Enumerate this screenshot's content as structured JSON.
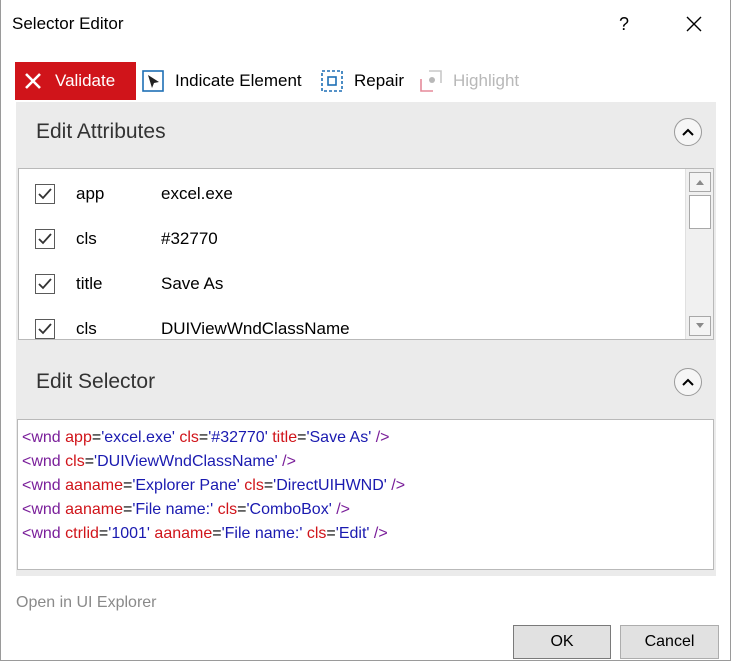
{
  "window": {
    "title": "Selector Editor",
    "help_label": "?"
  },
  "toolbar": {
    "validate_label": "Validate",
    "indicate_label": "Indicate Element",
    "repair_label": "Repair",
    "highlight_label": "Highlight"
  },
  "attributes_panel": {
    "title": "Edit Attributes",
    "rows": [
      {
        "checked": true,
        "name": "app",
        "value": "excel.exe"
      },
      {
        "checked": true,
        "name": "cls",
        "value": "#32770"
      },
      {
        "checked": true,
        "name": "title",
        "value": "Save As"
      },
      {
        "checked": true,
        "name": "cls",
        "value": "DUIViewWndClassName"
      }
    ]
  },
  "selector_panel": {
    "title": "Edit Selector",
    "lines": [
      [
        {
          "t": "tag",
          "v": "<wnd "
        },
        {
          "t": "an",
          "v": "app"
        },
        {
          "t": "eq",
          "v": "="
        },
        {
          "t": "av",
          "v": "'excel.exe'"
        },
        {
          "t": "eq",
          "v": " "
        },
        {
          "t": "an",
          "v": "cls"
        },
        {
          "t": "eq",
          "v": "="
        },
        {
          "t": "av",
          "v": "'#32770'"
        },
        {
          "t": "eq",
          "v": " "
        },
        {
          "t": "an",
          "v": "title"
        },
        {
          "t": "eq",
          "v": "="
        },
        {
          "t": "av",
          "v": "'Save As'"
        },
        {
          "t": "tag",
          "v": " />"
        }
      ],
      [
        {
          "t": "tag",
          "v": "<wnd "
        },
        {
          "t": "an",
          "v": "cls"
        },
        {
          "t": "eq",
          "v": "="
        },
        {
          "t": "av",
          "v": "'DUIViewWndClassName'"
        },
        {
          "t": "tag",
          "v": " />"
        }
      ],
      [
        {
          "t": "tag",
          "v": "<wnd "
        },
        {
          "t": "an",
          "v": "aaname"
        },
        {
          "t": "eq",
          "v": "="
        },
        {
          "t": "av",
          "v": "'Explorer Pane'"
        },
        {
          "t": "eq",
          "v": " "
        },
        {
          "t": "an",
          "v": "cls"
        },
        {
          "t": "eq",
          "v": "="
        },
        {
          "t": "av",
          "v": "'DirectUIHWND'"
        },
        {
          "t": "tag",
          "v": " />"
        }
      ],
      [
        {
          "t": "tag",
          "v": "<wnd "
        },
        {
          "t": "an",
          "v": "aaname"
        },
        {
          "t": "eq",
          "v": "="
        },
        {
          "t": "av",
          "v": "'File name:'"
        },
        {
          "t": "eq",
          "v": " "
        },
        {
          "t": "an",
          "v": "cls"
        },
        {
          "t": "eq",
          "v": "="
        },
        {
          "t": "av",
          "v": "'ComboBox'"
        },
        {
          "t": "tag",
          "v": " />"
        }
      ],
      [
        {
          "t": "tag",
          "v": "<wnd "
        },
        {
          "t": "an",
          "v": "ctrlid"
        },
        {
          "t": "eq",
          "v": "="
        },
        {
          "t": "av",
          "v": "'1001'"
        },
        {
          "t": "eq",
          "v": " "
        },
        {
          "t": "an",
          "v": "aaname"
        },
        {
          "t": "eq",
          "v": "="
        },
        {
          "t": "av",
          "v": "'File name:'"
        },
        {
          "t": "eq",
          "v": " "
        },
        {
          "t": "an",
          "v": "cls"
        },
        {
          "t": "eq",
          "v": "="
        },
        {
          "t": "av",
          "v": "'Edit'"
        },
        {
          "t": "tag",
          "v": " />"
        }
      ]
    ]
  },
  "footer": {
    "open_explorer_label": "Open in UI Explorer",
    "ok_label": "OK",
    "cancel_label": "Cancel"
  },
  "colors": {
    "validate_bg": "#d0141a",
    "tag": "#7a1f9a",
    "attr_name": "#d0141a",
    "attr_value": "#1a1ab0",
    "accent_blue": "#1e6fb5",
    "highlight_disabled": "#e58a9a"
  }
}
